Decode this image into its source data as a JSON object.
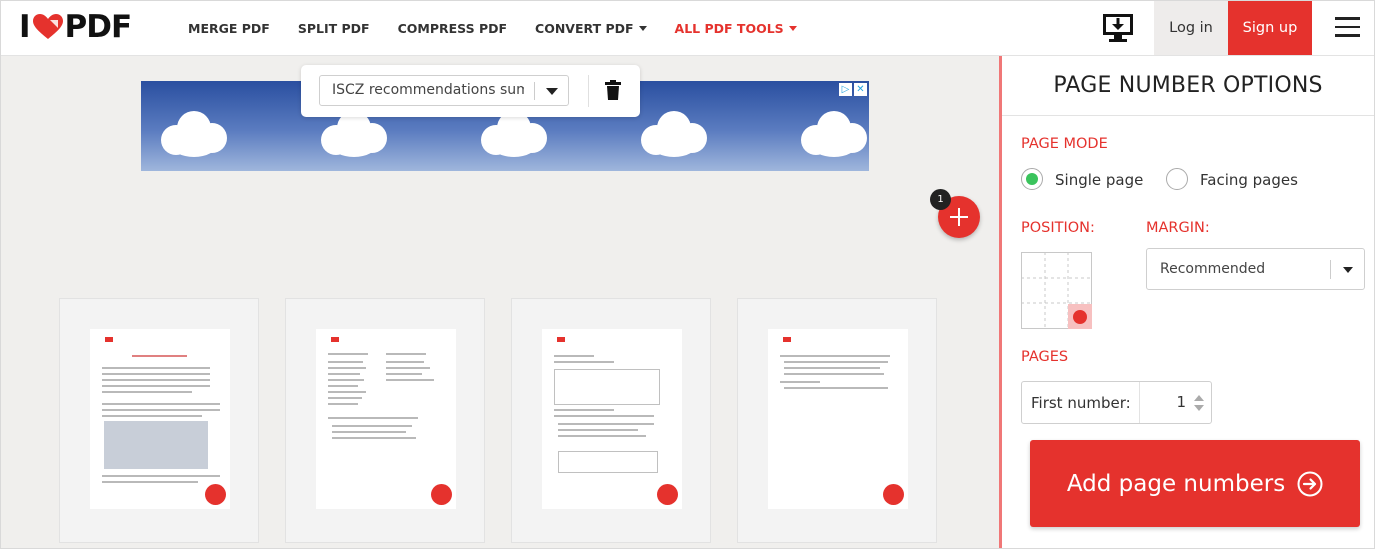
{
  "brand": {
    "logo_left": "I",
    "logo_right": "PDF",
    "accent": "#e5322d"
  },
  "nav": {
    "items": [
      {
        "label": "MERGE PDF",
        "dropdown": false,
        "highlight": false
      },
      {
        "label": "SPLIT PDF",
        "dropdown": false,
        "highlight": false
      },
      {
        "label": "COMPRESS PDF",
        "dropdown": false,
        "highlight": false
      },
      {
        "label": "CONVERT PDF",
        "dropdown": true,
        "highlight": false
      },
      {
        "label": "ALL PDF TOOLS",
        "dropdown": true,
        "highlight": true
      }
    ]
  },
  "header": {
    "desktop_icon": "desktop-download-icon",
    "login": "Log in",
    "signup": "Sign up",
    "menu_icon": "hamburger-menu-icon"
  },
  "file_popover": {
    "selected_file": "ISCZ recommendations summary",
    "delete_icon": "trash-icon"
  },
  "add_files": {
    "badge": "1",
    "icon": "plus-icon"
  },
  "pages": {
    "count": 4,
    "page_number_position": "bottom-right"
  },
  "sidebar": {
    "title": "PAGE NUMBER OPTIONS",
    "page_mode": {
      "label": "PAGE MODE",
      "options": [
        {
          "label": "Single page",
          "selected": true
        },
        {
          "label": "Facing pages",
          "selected": false
        }
      ]
    },
    "position": {
      "label": "POSITION:",
      "selected": "bottom-right"
    },
    "margin": {
      "label": "MARGIN:",
      "value": "Recommended"
    },
    "pages": {
      "label": "PAGES",
      "first_number_label": "First number:",
      "first_number_value": "1"
    },
    "submit": {
      "label": "Add page numbers",
      "icon": "arrow-right-circle-icon"
    }
  }
}
